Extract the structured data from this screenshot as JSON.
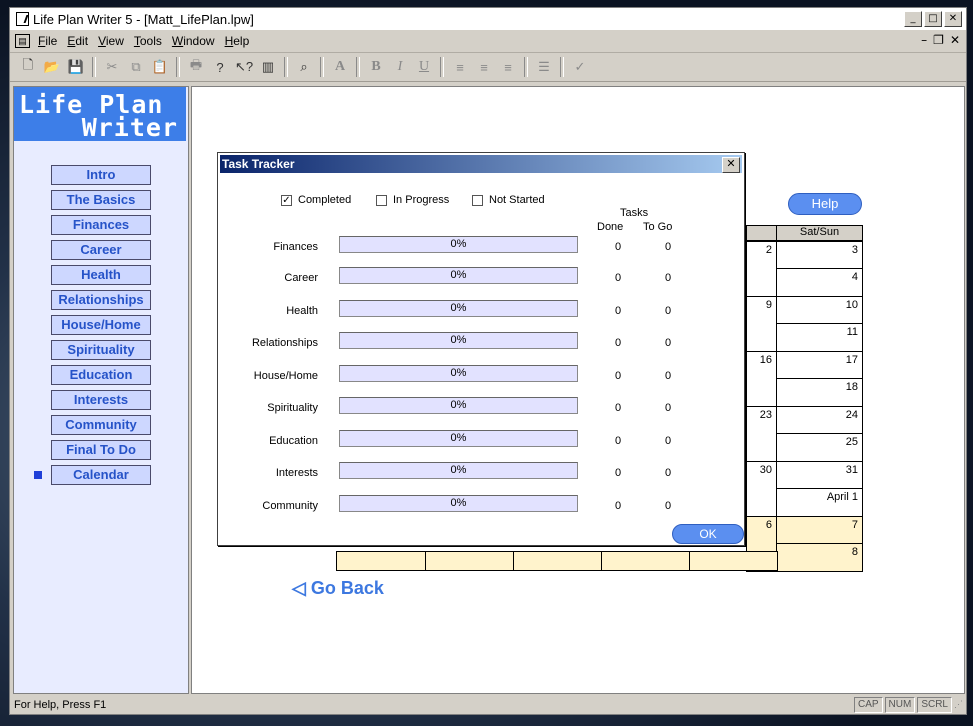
{
  "window": {
    "title": "Life Plan Writer 5 - [Matt_LifePlan.lpw]"
  },
  "menu": [
    "File",
    "Edit",
    "View",
    "Tools",
    "Window",
    "Help"
  ],
  "menu_underline": [
    "F",
    "E",
    "V",
    "T",
    "W",
    "H"
  ],
  "toolbar": [
    "new-file",
    "open-folder",
    "save",
    "cut",
    "copy",
    "paste",
    "print",
    "help",
    "context-help",
    "notes",
    "find",
    "font",
    "bold",
    "italic",
    "underline",
    "align-left",
    "align-center",
    "align-right",
    "bullets",
    "spell-check"
  ],
  "logo": {
    "line1": "Life Plan",
    "line2": "Writer"
  },
  "nav": [
    "Intro",
    "The Basics",
    "Finances",
    "Career",
    "Health",
    "Relationships",
    "House/Home",
    "Spirituality",
    "Education",
    "Interests",
    "Community",
    "Final To Do",
    "Calendar"
  ],
  "nav_selected": "Calendar",
  "page": {
    "help_label": "Help",
    "go_back_label": "Go Back",
    "calendar_header": "Sat/Sun",
    "calendar_fri": [
      "2",
      "9",
      "16",
      "23",
      "30",
      "6"
    ],
    "calendar_sat_sun": [
      "3",
      "4",
      "10",
      "11",
      "17",
      "18",
      "24",
      "25",
      "31",
      "April 1",
      "7",
      "8"
    ]
  },
  "dialog": {
    "title": "Task Tracker",
    "filters": [
      {
        "label": "Completed",
        "checked": true
      },
      {
        "label": "In Progress",
        "checked": false
      },
      {
        "label": "Not Started",
        "checked": false
      }
    ],
    "tasks_header": "Tasks",
    "col_done": "Done",
    "col_togo": "To Go",
    "rows": [
      {
        "label": "Finances",
        "percent": "0%",
        "progress": 0,
        "done": "0",
        "togo": "0"
      },
      {
        "label": "Career",
        "percent": "0%",
        "progress": 0,
        "done": "0",
        "togo": "0"
      },
      {
        "label": "Health",
        "percent": "0%",
        "progress": 0,
        "done": "0",
        "togo": "0"
      },
      {
        "label": "Relationships",
        "percent": "0%",
        "progress": 0,
        "done": "0",
        "togo": "0"
      },
      {
        "label": "House/Home",
        "percent": "0%",
        "progress": 0,
        "done": "0",
        "togo": "0"
      },
      {
        "label": "Spirituality",
        "percent": "0%",
        "progress": 0,
        "done": "0",
        "togo": "0"
      },
      {
        "label": "Education",
        "percent": "0%",
        "progress": 0,
        "done": "0",
        "togo": "0"
      },
      {
        "label": "Interests",
        "percent": "0%",
        "progress": 0,
        "done": "0",
        "togo": "0"
      },
      {
        "label": "Community",
        "percent": "0%",
        "progress": 0,
        "done": "0",
        "togo": "0"
      }
    ],
    "ok_label": "OK"
  },
  "status": {
    "text": "For Help, Press F1",
    "panes": [
      "CAP",
      "NUM",
      "SCRL"
    ]
  }
}
